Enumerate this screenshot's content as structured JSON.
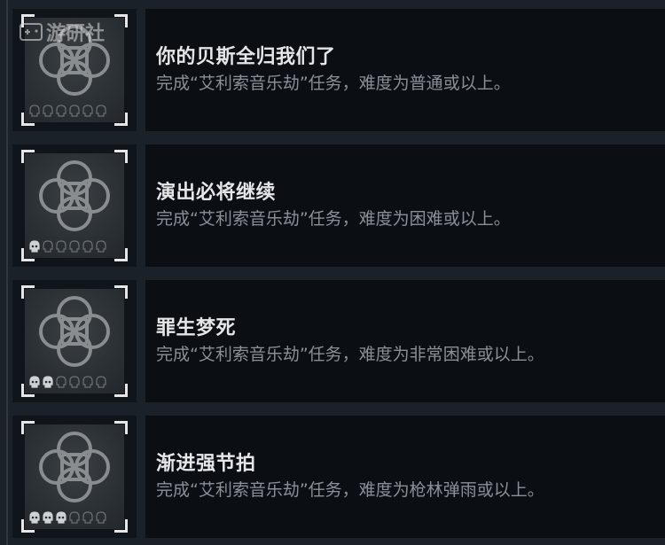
{
  "watermark": {
    "text": "游研社"
  },
  "achievements": [
    {
      "title": "你的贝斯全归我们了",
      "description": "完成“艾利索音乐劫”任务，难度为普通或以上。",
      "skulls_filled": 0
    },
    {
      "title": "演出必将继续",
      "description": "完成“艾利索音乐劫”任务，难度为困难或以上。",
      "skulls_filled": 1
    },
    {
      "title": "罪生梦死",
      "description": "完成“艾利索音乐劫”任务，难度为非常困难或以上。",
      "skulls_filled": 2
    },
    {
      "title": "渐进强节拍",
      "description": "完成“艾利索音乐劫”任务，难度为枪林弹雨或以上。",
      "skulls_filled": 3
    }
  ],
  "skull_count_total": 6,
  "colors": {
    "background": "#1b2129",
    "panel": "#0b0e13",
    "title": "#e4e6e8",
    "description": "#8b9097",
    "bracket": "#e6e6e6"
  }
}
